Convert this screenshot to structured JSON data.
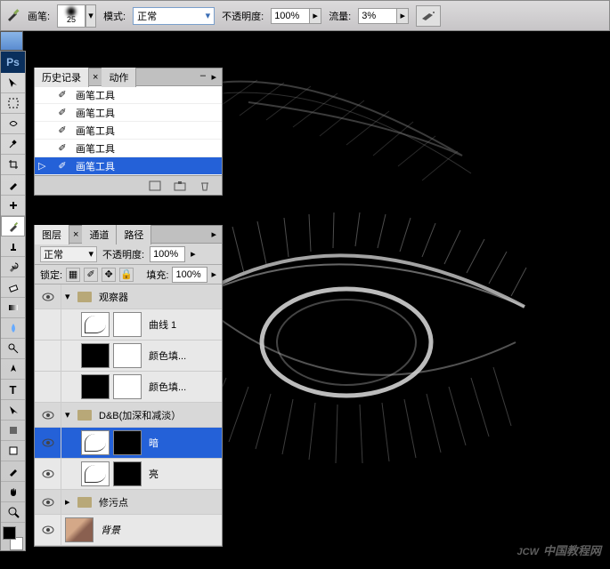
{
  "options_bar": {
    "brush_label": "画笔:",
    "brush_size": "25",
    "mode_label": "模式:",
    "mode_value": "正常",
    "opacity_label": "不透明度:",
    "opacity_value": "100%",
    "flow_label": "流量:",
    "flow_value": "3%"
  },
  "history_panel": {
    "tabs": {
      "history": "历史记录",
      "actions": "动作"
    },
    "items": [
      "画笔工具",
      "画笔工具",
      "画笔工具",
      "画笔工具",
      "画笔工具"
    ]
  },
  "layers_panel": {
    "tabs": {
      "layers": "图层",
      "channels": "通道",
      "paths": "路径"
    },
    "blend_mode": "正常",
    "opacity_label": "不透明度:",
    "opacity_value": "100%",
    "lock_label": "锁定:",
    "fill_label": "填充:",
    "fill_value": "100%",
    "groups": {
      "observer": "观察器",
      "db": "D&B(加深和减淡）",
      "cleanup": "修污点"
    },
    "layers": {
      "curves1": "曲线 1",
      "colorfill1": "颜色填...",
      "colorfill2": "颜色填...",
      "dark": "暗",
      "light": "亮",
      "background": "背景"
    }
  },
  "watermark": {
    "main": "JCW",
    "sub": "中国教程网"
  }
}
